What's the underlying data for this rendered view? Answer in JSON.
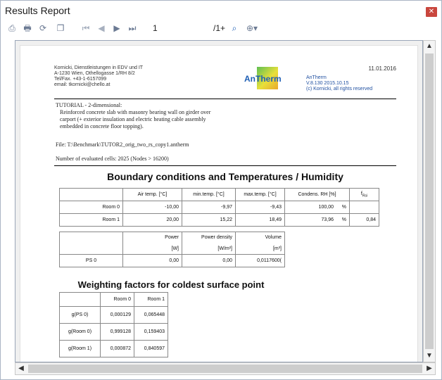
{
  "window": {
    "title": "Results Report"
  },
  "toolbar": {
    "page_value": "1",
    "page_total": "/1+",
    "icons": [
      "print-setup-icon",
      "print-icon",
      "refresh-icon",
      "copy-icon",
      "first-page-icon",
      "prev-page-icon",
      "next-page-icon",
      "last-page-icon",
      "find-icon",
      "zoom-icon"
    ]
  },
  "report": {
    "header_lines": [
      "Kornicki, Dienstleistungen in EDV und IT",
      "A-1230 Wien, Othellogasse 1/RH 8/2",
      "Tel/Fax. +43-1-6157099",
      "email: tkornicki@chello.at"
    ],
    "date": "11.01.2016",
    "logo_text": "AnTherm",
    "app_lines": [
      "AnTherm",
      "V.8.130 2015.10.15",
      "(c) Kornicki, all rights reserved"
    ],
    "tutorial_title": "TUTORIAL - 2-dimensional:",
    "tutorial_lines": [
      "Reinforced concrete slab with masonry bearing wall on girder over",
      "carport (+ exterior insulation and electric heating cable assembly",
      "embedded in concrete floor topping)."
    ],
    "file_line": "File: T:\\Benchmark\\TUTOR2_orig_two_rs_copy1.antherm",
    "cells_line": "Number of evaluated cells: 2025 (Nodes > 16200)",
    "section1_title": "Boundary conditions and Temperatures / Humidity",
    "bc_table": {
      "headers": [
        "",
        "Air temp. [°C]",
        "min.temp. [°C]",
        "max.temp. [°C]",
        "Condens. RH [%]",
        "f",
        "Rsi"
      ],
      "rows": [
        {
          "label": "Room 0",
          "air": "-10,00",
          "min": "-9,97",
          "max": "-9,43",
          "rh": "100,00",
          "pct": "%",
          "f": ""
        },
        {
          "label": "Room 1",
          "air": "20,00",
          "min": "15,22",
          "max": "18,49",
          "rh": "73,96",
          "pct": "%",
          "f": "0,84"
        }
      ]
    },
    "ps_table": {
      "headers": [
        "",
        "Power",
        "Power density",
        "Volume"
      ],
      "units": [
        "",
        "[W]",
        "[W/m²]",
        "[m³]"
      ],
      "rows": [
        {
          "label": "PS 0",
          "power": "0,00",
          "density": "0,00",
          "volume": "0,0117600("
        }
      ]
    },
    "section2_title": "Weighting factors for coldest surface point",
    "wf_table": {
      "headers": [
        "",
        "Room 0",
        "Room 1"
      ],
      "rows": [
        {
          "label": "g(PS 0)",
          "r0": "0,000129",
          "r1": "0,065448"
        },
        {
          "label": "g(Room 0)",
          "r0": "0,999128",
          "r1": "0,159403"
        },
        {
          "label": "g(Room 1)",
          "r0": "0,000872",
          "r1": "0,840597"
        }
      ]
    }
  }
}
